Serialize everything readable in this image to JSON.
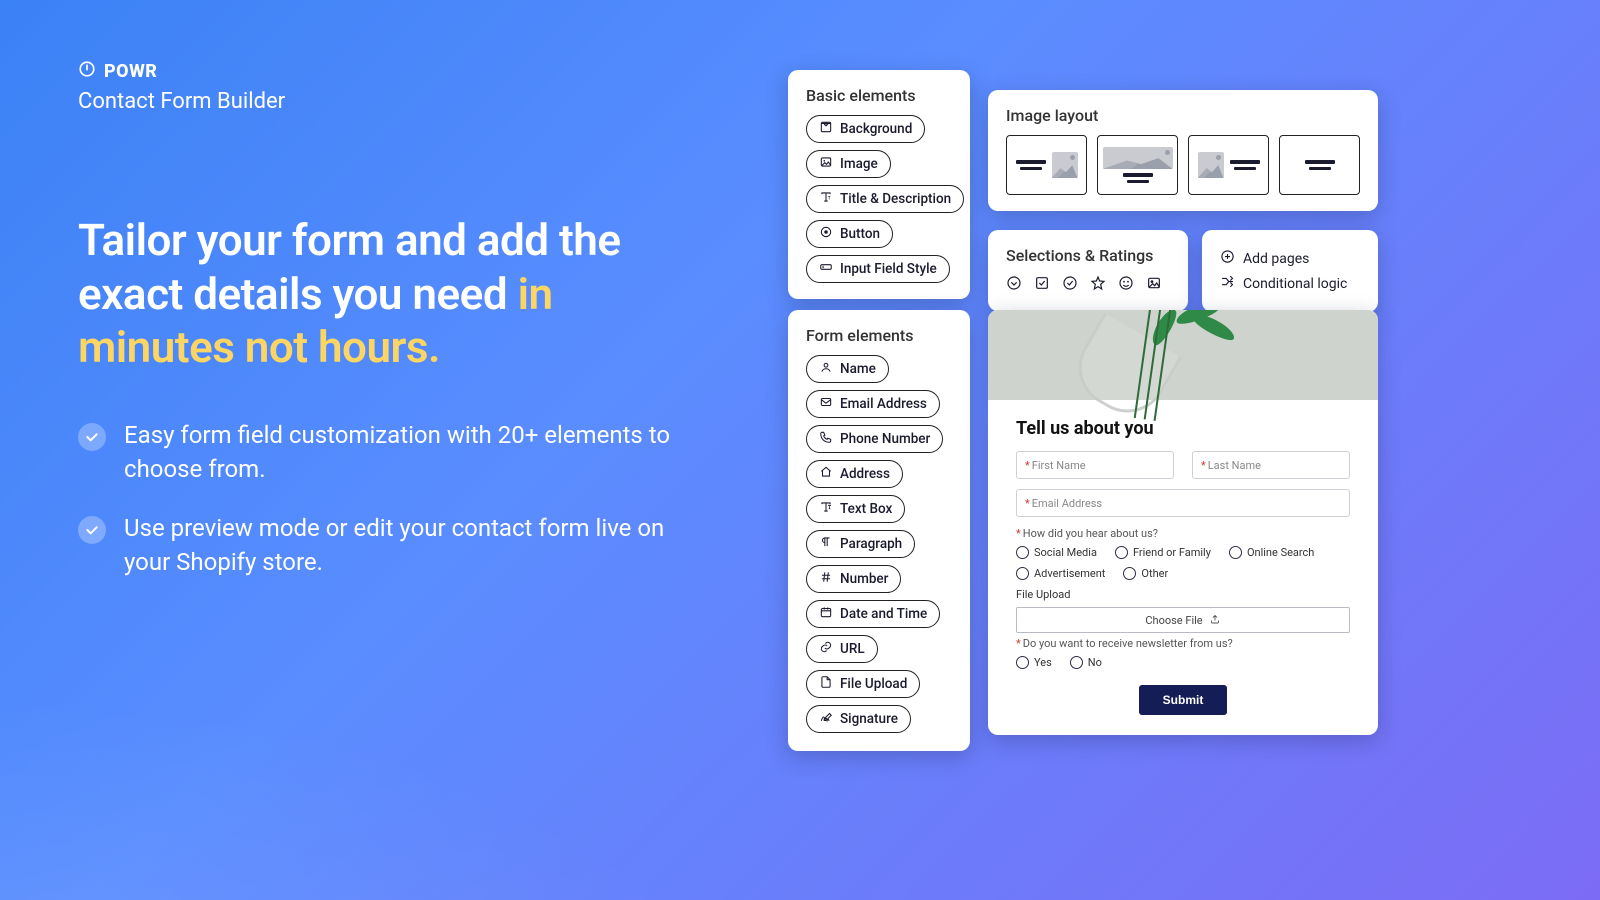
{
  "brand": {
    "name": "POWR",
    "product": "Contact Form Builder"
  },
  "headline": {
    "part1": "Tailor your form and add the exact details you need ",
    "accent": "in minutes not hours."
  },
  "bullets": [
    "Easy form field customization with 20+ elements to choose from.",
    "Use preview mode or edit your contact form live on your Shopify store."
  ],
  "basic": {
    "title": "Basic elements",
    "items": [
      {
        "icon": "background",
        "label": "Background"
      },
      {
        "icon": "image",
        "label": "Image"
      },
      {
        "icon": "title",
        "label": "Title & Description"
      },
      {
        "icon": "button",
        "label": "Button"
      },
      {
        "icon": "inputstyle",
        "label": "Input Field Style"
      }
    ]
  },
  "formEls": {
    "title": "Form elements",
    "items": [
      {
        "icon": "name",
        "label": "Name"
      },
      {
        "icon": "email",
        "label": "Email Address"
      },
      {
        "icon": "phone",
        "label": "Phone Number"
      },
      {
        "icon": "address",
        "label": "Address"
      },
      {
        "icon": "textbox",
        "label": "Text Box"
      },
      {
        "icon": "paragraph",
        "label": "Paragraph"
      },
      {
        "icon": "number",
        "label": "Number"
      },
      {
        "icon": "datetime",
        "label": "Date and Time"
      },
      {
        "icon": "url",
        "label": "URL"
      },
      {
        "icon": "file",
        "label": "File Upload"
      },
      {
        "icon": "signature",
        "label": "Signature"
      }
    ]
  },
  "layout": {
    "title": "Image layout"
  },
  "selections": {
    "title": "Selections & Ratings"
  },
  "features": {
    "add_pages": "Add pages",
    "conditional": "Conditional logic"
  },
  "preview": {
    "title": "Tell us about you",
    "first_name_ph": "First Name",
    "last_name_ph": "Last Name",
    "email_ph": "Email Address",
    "hear_label": "How did you hear about us?",
    "hear_options": [
      "Social Media",
      "Friend or Family",
      "Online Search",
      "Advertisement",
      "Other"
    ],
    "file_label": "File Upload",
    "choose_file": "Choose File",
    "newsletter_label": "Do you want to receive newsletter from us?",
    "newsletter_options": [
      "Yes",
      "No"
    ],
    "submit": "Submit"
  }
}
